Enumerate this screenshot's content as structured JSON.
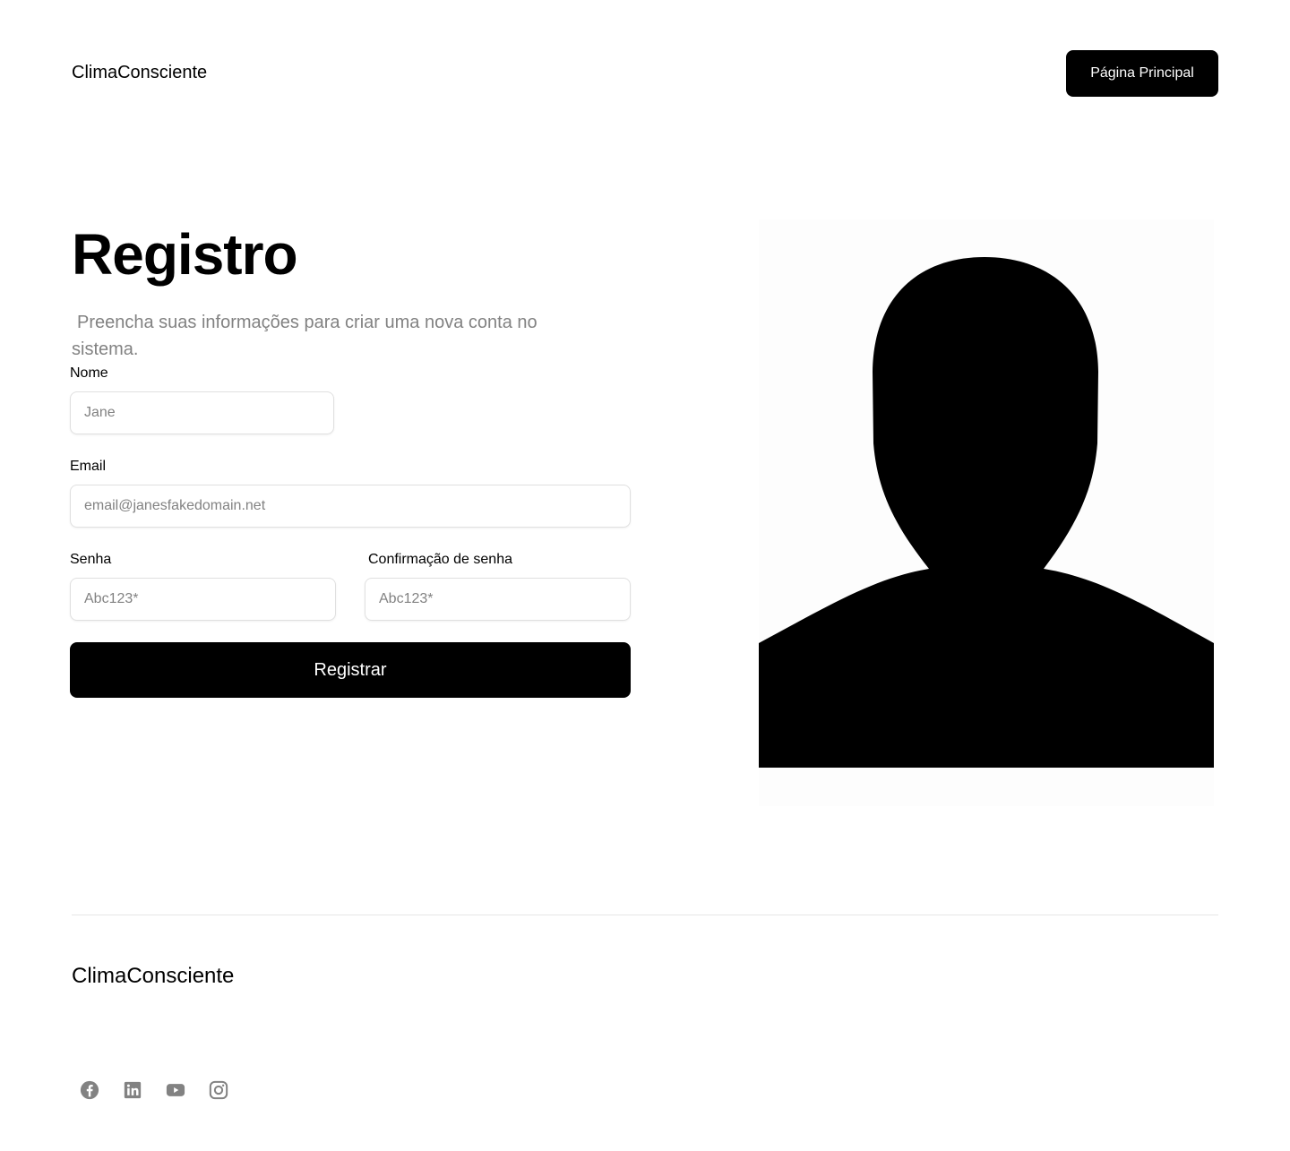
{
  "header": {
    "brand": "ClimaConsciente",
    "home_button": "Página Principal"
  },
  "main": {
    "title": "Registro",
    "subtitle": "Preencha suas informações para criar uma nova conta no sistema.",
    "fields": {
      "name": {
        "label": "Nome",
        "placeholder": "Jane"
      },
      "email": {
        "label": "Email",
        "placeholder": "email@janesfakedomain.net"
      },
      "password": {
        "label": "Senha",
        "placeholder": "Abc123*"
      },
      "password_confirm": {
        "label": "Confirmação de senha",
        "placeholder": "Abc123*"
      }
    },
    "submit_label": "Registrar",
    "avatar_icon": "user-silhouette-icon"
  },
  "footer": {
    "brand": "ClimaConsciente",
    "social_icons": [
      "facebook-icon",
      "linkedin-icon",
      "youtube-icon",
      "instagram-icon"
    ],
    "icon_color": "#828282"
  },
  "colors": {
    "primary": "#000000",
    "muted_text": "#828282",
    "border": "#e0e0e0",
    "background": "#ffffff"
  }
}
